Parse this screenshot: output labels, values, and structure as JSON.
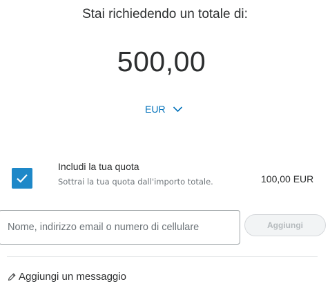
{
  "request": {
    "heading": "Stai richiedendo un totale di:",
    "amount": "500,00",
    "currency": "EUR",
    "currency_icon": "chevron-down-icon"
  },
  "fee": {
    "checked": true,
    "title": "Includi la tua quota",
    "description": "Sottrai la tua quota dall'importo totale.",
    "amount": "100,00 EUR"
  },
  "recipient": {
    "placeholder": "Nome, indirizzo email o numero di cellulare",
    "add_label": "Aggiungi"
  },
  "message": {
    "icon": "pencil-icon",
    "label": "Aggiungi un messaggio"
  },
  "colors": {
    "accent": "#0070ba",
    "checkbox": "#1e88c8",
    "text": "#2c2e2f",
    "muted": "#6c7378"
  }
}
